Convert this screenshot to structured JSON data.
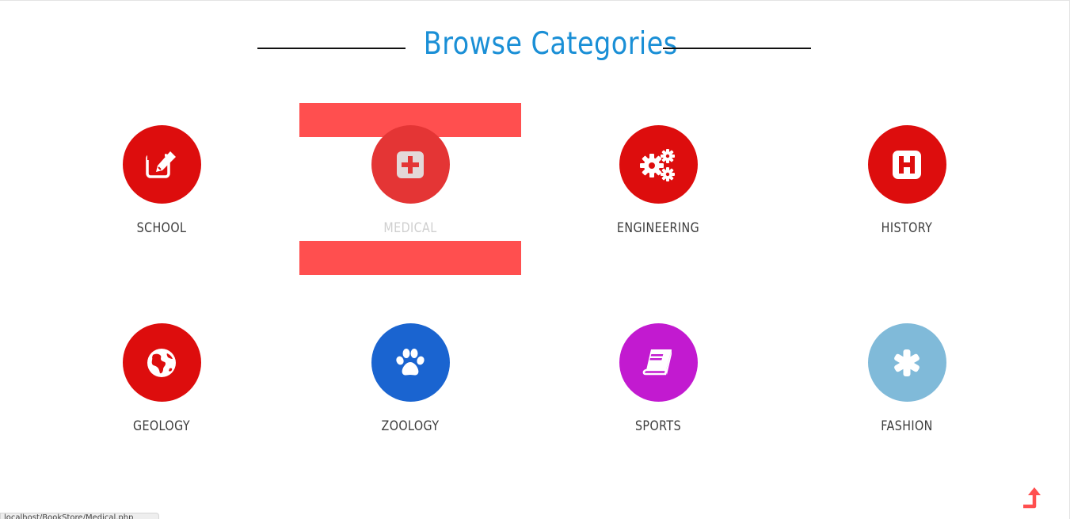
{
  "heading": {
    "title": "Browse Categories"
  },
  "categories": [
    {
      "label": "SCHOOL",
      "icon": "edit-icon",
      "color": "#dd0d0d"
    },
    {
      "label": "MEDICAL",
      "icon": "medical-kit-icon",
      "color": "#e43535"
    },
    {
      "label": "ENGINEERING",
      "icon": "gears-icon",
      "color": "#dd0d0d"
    },
    {
      "label": "HISTORY",
      "icon": "hospital-h-icon",
      "color": "#dd0d0d"
    },
    {
      "label": "GEOLOGY",
      "icon": "globe-icon",
      "color": "#dd0d0d"
    },
    {
      "label": "ZOOLOGY",
      "icon": "paw-icon",
      "color": "#1a64d0"
    },
    {
      "label": "SPORTS",
      "icon": "book-icon",
      "color": "#c21ad0"
    },
    {
      "label": "FASHION",
      "icon": "asterisk-icon",
      "color": "#80bad9"
    }
  ],
  "hover_state": {
    "active_category": "MEDICAL",
    "accent": "#ff4f4f",
    "label_color": "#cfcfcf"
  },
  "status_bar": {
    "url": "localhost/BookStore/Medical.php"
  },
  "back_to_top": {
    "icon": "arrow-turn-up-icon",
    "color": "#ff4f4f"
  }
}
